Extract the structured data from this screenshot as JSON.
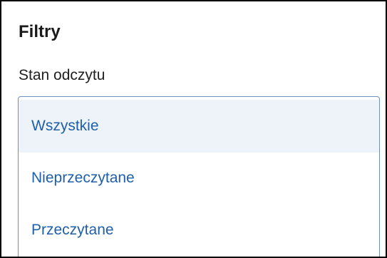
{
  "panel": {
    "title": "Filtry",
    "field_label": "Stan odczytu"
  },
  "read_state_select": {
    "selected_value": "Wszystkie",
    "options": [
      {
        "label": "Wszystkie",
        "selected": true
      },
      {
        "label": "Nieprzeczytane",
        "selected": false
      },
      {
        "label": "Przeczytane",
        "selected": false
      }
    ]
  },
  "colors": {
    "option_text": "#1f5fa8",
    "selected_bg": "#eef3f9",
    "border": "#6f8fbf",
    "panel_border": "#000000"
  }
}
